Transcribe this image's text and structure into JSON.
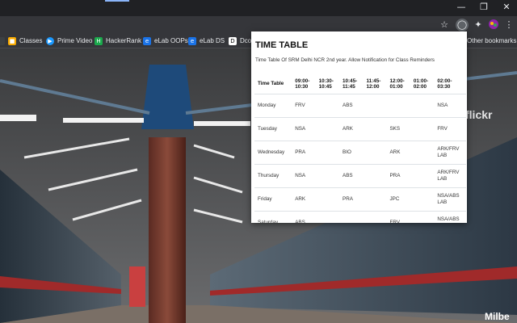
{
  "toolbar": {
    "star_icon": "star-outline-icon",
    "extension_icon": "circle-extension-icon",
    "puzzle_icon": "puzzle-icon",
    "profile_icon": "avatar",
    "menu_icon": "kebab-menu-icon"
  },
  "bookmarks": {
    "items": [
      {
        "label": "Classes",
        "icon": "google-classroom-icon",
        "color": "#f9ab00"
      },
      {
        "label": "Prime Video",
        "icon": "play-circle-icon",
        "color": "#1a98ff"
      },
      {
        "label": "HackerRank",
        "icon": "hackerrank-icon",
        "color": "#2ec866"
      },
      {
        "label": "eLab OOPs",
        "icon": "elab-icon",
        "color": "#1a73e8"
      },
      {
        "label": "eLab DS",
        "icon": "elab-icon",
        "color": "#1a73e8"
      },
      {
        "label": "Dcod",
        "icon": "dcoder-icon",
        "color": "#ffffff"
      }
    ],
    "other": "Other bookmarks"
  },
  "background": {
    "watermark": "flickr",
    "sign": "Milbe"
  },
  "popup": {
    "title": "TIME TABLE",
    "description": "Time Table Of SRM Delhi NCR 2nd year. Allow Notification for Class Reminders",
    "headers": [
      "Time Table",
      "09:00-\n10:30",
      "10:30-\n10:45",
      "10:45-\n11:45",
      "11:45-\n12:00",
      "12:00-\n01:00",
      "01:00-\n02:00",
      "02:00-\n03:30"
    ],
    "rows": [
      [
        "Monday",
        "FRV",
        "",
        "ABS",
        "",
        "",
        "",
        "NSA"
      ],
      [
        "Tuesday",
        "NSA",
        "",
        "ARK",
        "",
        "SKS",
        "",
        "FRV"
      ],
      [
        "Wednesday",
        "PRA",
        "",
        "BIO",
        "",
        "ARK",
        "",
        "ARK/FRV\nLAB"
      ],
      [
        "Thursday",
        "NSA",
        "",
        "ABS",
        "",
        "PRA",
        "",
        "ARK/FRV\nLAB"
      ],
      [
        "Friday",
        "ARK",
        "",
        "PRA",
        "",
        "JPC",
        "",
        "NSA/ABS\nLAB"
      ],
      [
        "Saturday",
        "ABS",
        "",
        "",
        "",
        "FRV",
        "",
        "NSA/ABS\nLAB"
      ]
    ]
  }
}
